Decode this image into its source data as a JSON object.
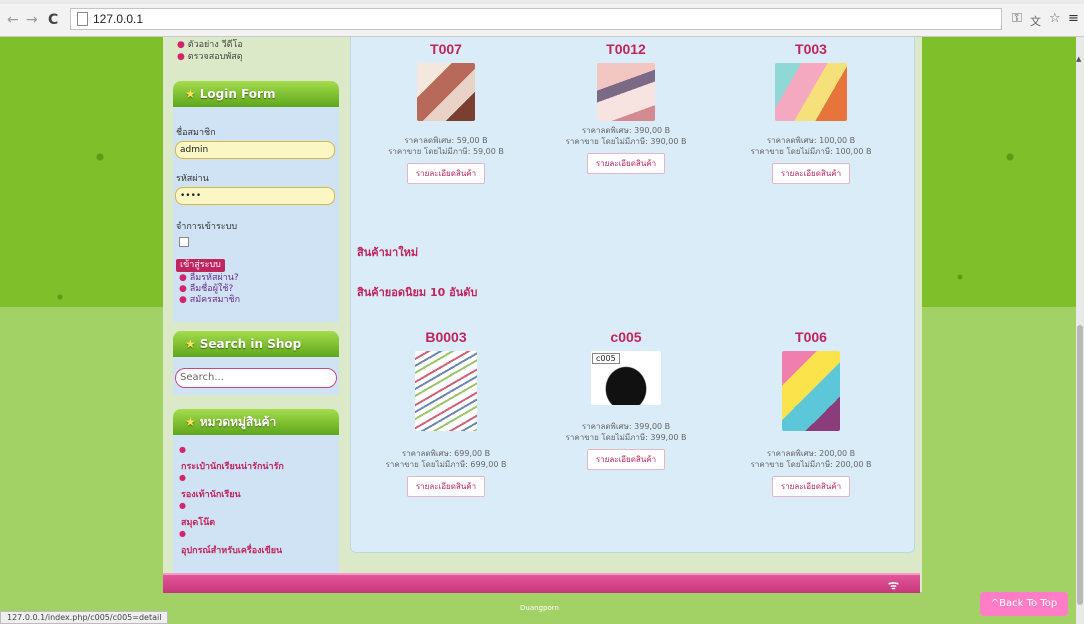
{
  "browser": {
    "url": "127.0.0.1",
    "status_url": "127.0.0.1/index.php/c005/c005=detail"
  },
  "sidebar": {
    "top_links": [
      "ตัวอย่าง วีดีโอ",
      "ตรวจสอบพัสดุ"
    ],
    "login": {
      "title": "Login Form",
      "username_label": "ชื่อสมาชิก",
      "username_value": "admin",
      "password_label": "รหัสผ่าน",
      "password_value": "••••",
      "remember_label": "จำการเข้าระบบ",
      "login_button": "เข้าสู่ระบบ",
      "links": [
        "ลืมรหัสผ่าน?",
        "ลืมชื่อผู้ใช้?",
        "สมัครสมาชิก"
      ]
    },
    "search": {
      "title": "Search in Shop",
      "placeholder": "Search..."
    },
    "categories": {
      "title": "หมวดหมู่สินค้า",
      "items": [
        "กระเป๋านักเรียนน่ารักน่ารัก",
        "รองเท้านักเรียน",
        "สมุดโน๊ต",
        "อุปกรณ์สำหรับเครื่องเขียน"
      ]
    }
  },
  "main": {
    "row1": [
      {
        "code": "T007",
        "special_price": "ราคาลดพิเศษ: 59,00 B",
        "normal_price": "ราคาขาย โดยไม่มีภาษี: 59,00 B",
        "button": "รายละเอียดสินค้า"
      },
      {
        "code": "T0012",
        "special_price": "ราคาลดพิเศษ: 390,00 B",
        "normal_price": "ราคาขาย โดยไม่มีภาษี: 390,00 B",
        "button": "รายละเอียดสินค้า"
      },
      {
        "code": "T003",
        "special_price": "ราคาลดพิเศษ: 100,00 B",
        "normal_price": "ราคาขาย โดยไม่มีภาษี: 100,00 B",
        "button": "รายละเอียดสินค้า"
      }
    ],
    "new_products_title": "สินค้ามาใหม่",
    "top_products_title": "สินค้ายอดนิยม 10 อันดับ",
    "row2": [
      {
        "code": "B0003",
        "special_price": "ราคาลดพิเศษ: 699,00 B",
        "normal_price": "ราคาขาย โดยไม่มีภาษี: 699,00 B",
        "button": "รายละเอียดสินค้า"
      },
      {
        "code": "c005",
        "tooltip": "c005",
        "special_price": "ราคาลดพิเศษ: 399,00 B",
        "normal_price": "ราคาขาย โดยไม่มีภาษี: 399,00 B",
        "button": "รายละเอียดสินค้า"
      },
      {
        "code": "T006",
        "special_price": "ราคาลดพิเศษ: 200,00 B",
        "normal_price": "ราคาขาย โดยไม่มีภาษี: 200,00 B",
        "button": "รายละเอียดสินค้า"
      }
    ]
  },
  "footer": {
    "credit": "Duangporn",
    "back_to_top": "^Back To Top"
  }
}
